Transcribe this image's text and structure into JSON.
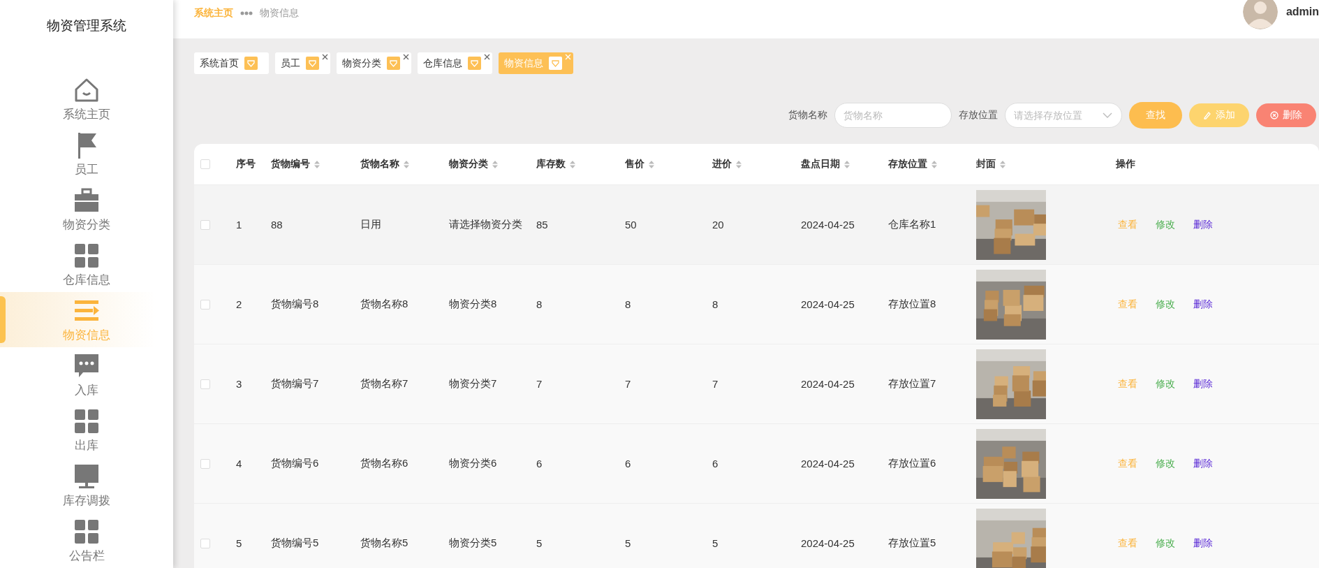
{
  "sidebar": {
    "title": "物资管理系统",
    "items": [
      {
        "label": "系统主页",
        "kind": "home",
        "selected": false
      },
      {
        "label": "员工",
        "kind": "flag",
        "selected": false
      },
      {
        "label": "物资分类",
        "kind": "case",
        "selected": false
      },
      {
        "label": "仓库信息",
        "kind": "grid",
        "selected": false
      },
      {
        "label": "物资信息",
        "kind": "list",
        "selected": true
      },
      {
        "label": "入库",
        "kind": "chat",
        "selected": false
      },
      {
        "label": "出库",
        "kind": "grid",
        "selected": false
      },
      {
        "label": "库存调拨",
        "kind": "monitor",
        "selected": false
      },
      {
        "label": "公告栏",
        "kind": "grid",
        "selected": false
      }
    ]
  },
  "breadcrumb": [
    {
      "label": "系统主页",
      "selected": true
    },
    {
      "label": "物资信息",
      "selected": false
    }
  ],
  "user": {
    "name": "admin"
  },
  "tabs": [
    {
      "label": "系统首页",
      "closable": false,
      "selected": false
    },
    {
      "label": "员工",
      "closable": true,
      "selected": false
    },
    {
      "label": "物资分类",
      "closable": true,
      "selected": false
    },
    {
      "label": "仓库信息",
      "closable": true,
      "selected": false
    },
    {
      "label": "物资信息",
      "closable": true,
      "selected": true
    }
  ],
  "search": {
    "fields": [
      {
        "label": "货物名称",
        "kind": "input",
        "placeholder": "货物名称"
      },
      {
        "label": "存放位置",
        "kind": "select",
        "placeholder": "请选择存放位置"
      }
    ],
    "buttons": [
      {
        "label": "查找",
        "kind": "search"
      },
      {
        "label": "添加",
        "kind": "add"
      },
      {
        "label": "删除",
        "kind": "delete"
      }
    ]
  },
  "table": {
    "select_all": {
      "checked": false
    },
    "columns": [
      {
        "label": "序号",
        "sortable": false
      },
      {
        "label": "货物编号",
        "sortable": true
      },
      {
        "label": "货物名称",
        "sortable": true
      },
      {
        "label": "物资分类",
        "sortable": true
      },
      {
        "label": "库存数",
        "sortable": true
      },
      {
        "label": "售价",
        "sortable": true
      },
      {
        "label": "进价",
        "sortable": true
      },
      {
        "label": "盘点日期",
        "sortable": true
      },
      {
        "label": "存放位置",
        "sortable": true
      },
      {
        "label": "封面",
        "sortable": true
      },
      {
        "label": "操作",
        "sortable": false
      }
    ],
    "rows": [
      {
        "checked": false,
        "cells": [
          "1",
          "88",
          "日用",
          "请选择物资分类",
          "85",
          "50",
          "20",
          "2024-04-25",
          "仓库名称1"
        ],
        "actions": [
          "查看",
          "修改",
          "删除"
        ]
      },
      {
        "checked": false,
        "cells": [
          "2",
          "货物编号8",
          "货物名称8",
          "物资分类8",
          "8",
          "8",
          "8",
          "2024-04-25",
          "存放位置8"
        ],
        "actions": [
          "查看",
          "修改",
          "删除"
        ]
      },
      {
        "checked": false,
        "cells": [
          "3",
          "货物编号7",
          "货物名称7",
          "物资分类7",
          "7",
          "7",
          "7",
          "2024-04-25",
          "存放位置7"
        ],
        "actions": [
          "查看",
          "修改",
          "删除"
        ]
      },
      {
        "checked": false,
        "cells": [
          "4",
          "货物编号6",
          "货物名称6",
          "物资分类6",
          "6",
          "6",
          "6",
          "2024-04-25",
          "存放位置6"
        ],
        "actions": [
          "查看",
          "修改",
          "删除"
        ]
      },
      {
        "checked": false,
        "cells": [
          "5",
          "货物编号5",
          "货物名称5",
          "物资分类5",
          "5",
          "5",
          "5",
          "2024-04-25",
          "存放位置5"
        ],
        "actions": [
          "查看",
          "修改",
          "删除"
        ]
      }
    ]
  }
}
